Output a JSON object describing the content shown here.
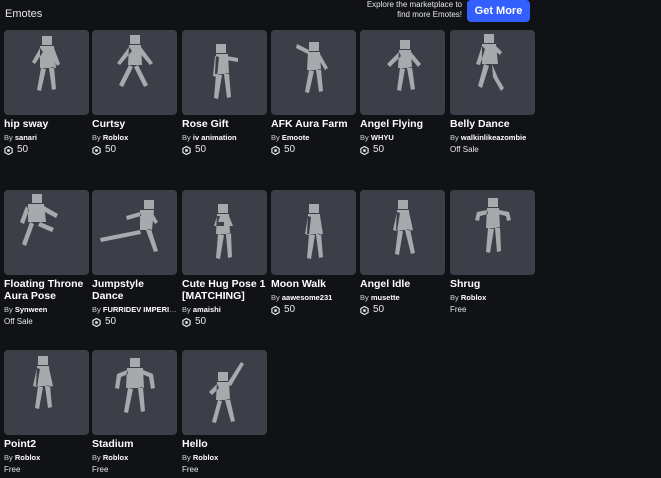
{
  "header": {
    "title": "Emotes",
    "promo_line1": "Explore the marketplace to",
    "promo_line2": "find more Emotes!",
    "get_more_label": "Get More"
  },
  "by_prefix": "By",
  "colors": {
    "accent": "#335fff",
    "card_bg": "#3c3f48",
    "page_bg": "#111216",
    "figure": "#a8a9ad"
  },
  "items": [
    {
      "name": "hip sway",
      "creator": "sanari",
      "price": "50",
      "currency": "robux",
      "pose": "sway"
    },
    {
      "name": "Curtsy",
      "creator": "Roblox",
      "price": "50",
      "currency": "robux",
      "pose": "curtsy"
    },
    {
      "name": "Rose Gift",
      "creator": "iv animation",
      "price": "50",
      "currency": "robux",
      "pose": "gift"
    },
    {
      "name": "AFK Aura Farm",
      "creator": "Emoote",
      "price": "50",
      "currency": "robux",
      "pose": "afk"
    },
    {
      "name": "Angel Flying",
      "creator": "WHYU",
      "price": "50",
      "currency": "robux",
      "pose": "fly"
    },
    {
      "name": "Belly Dance",
      "creator": "walkinlikeazombie",
      "price": "Off Sale",
      "currency": "none",
      "pose": "belly"
    },
    {
      "name": "Floating Throne Aura Pose",
      "creator": "Synween",
      "price": "Off Sale",
      "currency": "none",
      "pose": "throne"
    },
    {
      "name": "Jumpstyle Dance",
      "creator": "FURRIDEV IMPERIL...",
      "price": "50",
      "currency": "robux",
      "pose": "jump"
    },
    {
      "name": "Cute Hug Pose 1 [MATCHING]",
      "creator": "amaishi",
      "price": "50",
      "currency": "robux",
      "pose": "hug"
    },
    {
      "name": "Moon Walk",
      "creator": "aawesome231",
      "price": "50",
      "currency": "robux",
      "pose": "moon"
    },
    {
      "name": "Angel Idle",
      "creator": "musette",
      "price": "50",
      "currency": "robux",
      "pose": "idle"
    },
    {
      "name": "Shrug",
      "creator": "Roblox",
      "price": "Free",
      "currency": "none",
      "pose": "shrug"
    },
    {
      "name": "Point2",
      "creator": "Roblox",
      "price": "Free",
      "currency": "none",
      "pose": "point"
    },
    {
      "name": "Stadium",
      "creator": "Roblox",
      "price": "Free",
      "currency": "none",
      "pose": "stadium"
    },
    {
      "name": "Hello",
      "creator": "Roblox",
      "price": "Free",
      "currency": "none",
      "pose": "hello"
    }
  ]
}
